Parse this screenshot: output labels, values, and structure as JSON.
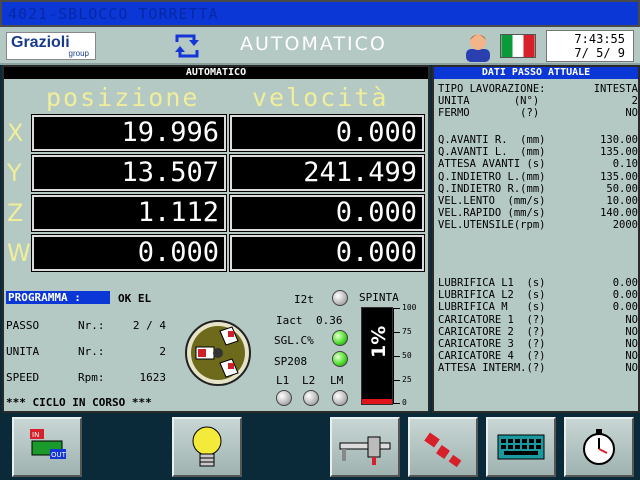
{
  "alarm_bar": {
    "text": "4021-SBLOCCO TORRETTA"
  },
  "header": {
    "logo": "Grazioli",
    "logo_sub": "group",
    "mode_title": "AUTOMATICO",
    "time": "7:43:55",
    "date": "7/ 5/ 9",
    "icons": [
      "refresh-cycle-icon",
      "operator-icon",
      "italian-flag-icon"
    ]
  },
  "left_panel": {
    "title": "AUTOMATICO",
    "position_header": "posizione",
    "velocity_header": "velocità",
    "axes": [
      {
        "axis": "X",
        "position": "19.996",
        "velocity": "0.000"
      },
      {
        "axis": "Y",
        "position": "13.507",
        "velocity": "241.499"
      },
      {
        "axis": "Z",
        "position": "1.112",
        "velocity": "0.000"
      },
      {
        "axis": "W",
        "position": "0.000",
        "velocity": "0.000"
      }
    ],
    "program_label": "PROGRAMMA  :",
    "program_value": "OK EL",
    "rows": [
      {
        "label": "PASSO",
        "mid": "Nr.:",
        "value": "2 / 4"
      },
      {
        "label": "UNITA",
        "mid": "Nr.:",
        "value": "2"
      },
      {
        "label": "SPEED",
        "mid": "Rpm:",
        "value": "1623"
      }
    ],
    "cycle_status": "*** CICLO IN CORSO ***",
    "signals": {
      "i2t": "I2t",
      "iact_label": "Iact",
      "iact_value": "0.36",
      "sgl": "SGL.C%",
      "sp208": "SP208",
      "l1": "L1",
      "l2": "L2",
      "lm": "LM",
      "leds": {
        "i2t": "off",
        "sgl": "on",
        "sp208": "on",
        "l1": "off",
        "l2": "off",
        "lm": "off"
      }
    },
    "spinta": {
      "label": "SPINTA",
      "display": "1%",
      "level_percent": 1,
      "ticks": [
        "100",
        "75",
        "50",
        "25",
        "0"
      ]
    }
  },
  "right_panel": {
    "title": "DATI PASSO ATTUALE",
    "group1": [
      {
        "label": "TIPO LAVORAZIONE:",
        "value": "INTESTA"
      },
      {
        "label": "UNITA       (N°)",
        "value": "2"
      },
      {
        "label": "FERMO        (?)",
        "value": "NO"
      }
    ],
    "group2": [
      {
        "label": "Q.AVANTI R.  (mm)",
        "value": "130.00"
      },
      {
        "label": "Q.AVANTI L.  (mm)",
        "value": "135.00"
      },
      {
        "label": "ATTESA AVANTI (s)",
        "value": "0.10"
      },
      {
        "label": "Q.INDIETRO L.(mm)",
        "value": "135.00"
      },
      {
        "label": "Q.INDIETRO R.(mm)",
        "value": "50.00"
      },
      {
        "label": "VEL.LENTO  (mm/s)",
        "value": "10.00"
      },
      {
        "label": "VEL.RAPIDO (mm/s)",
        "value": "140.00"
      },
      {
        "label": "VEL.UTENSILE(rpm)",
        "value": "2000"
      }
    ],
    "group3": [
      {
        "label": "LUBRIFICA L1  (s)",
        "value": "0.00"
      },
      {
        "label": "LUBRIFICA L2  (s)",
        "value": "0.00"
      },
      {
        "label": "LUBRIFICA M   (s)",
        "value": "0.00"
      },
      {
        "label": "CARICATORE 1  (?)",
        "value": "NO"
      },
      {
        "label": "CARICATORE 2  (?)",
        "value": "NO"
      },
      {
        "label": "CARICATORE 3  (?)",
        "value": "NO"
      },
      {
        "label": "CARICATORE 4  (?)",
        "value": "NO"
      },
      {
        "label": "ATTESA INTERM.(?)",
        "value": "NO"
      }
    ]
  },
  "bottom_buttons": [
    {
      "icon": "io-diagnostics-icon",
      "label_in": "IN",
      "label_out": "OUT"
    },
    {
      "icon": "light-bulb-icon"
    },
    {
      "icon": "caliper-icon"
    },
    {
      "icon": "tools-icon"
    },
    {
      "icon": "keyboard-icon"
    },
    {
      "icon": "stopwatch-icon"
    }
  ],
  "colors": {
    "accent_blue": "#0b37d6",
    "panel": "#b4c8c4",
    "label_yellow": "#f0ee9a",
    "led_green": "#4fe02e",
    "bar_red": "#e0151c"
  }
}
